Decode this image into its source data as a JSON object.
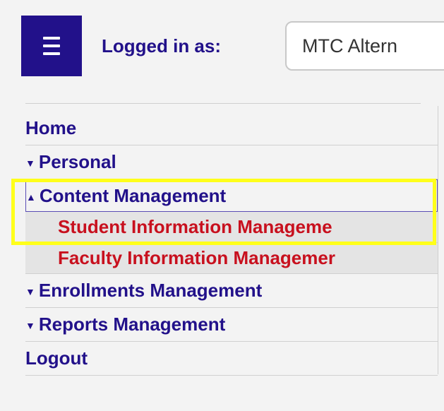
{
  "header": {
    "logged_in_label": "Logged in as:",
    "user_value": "MTC Altern"
  },
  "nav": {
    "home": "Home",
    "personal": "Personal",
    "content_management": "Content Management",
    "student_info": "Student Information Manageme",
    "faculty_info": "Faculty Information Managemer",
    "enrollments": "Enrollments Management",
    "reports": "Reports Management",
    "logout": "Logout"
  },
  "icons": {
    "menu": "hamburger-menu-icon",
    "collapsed_arrow": "triangle-down",
    "expanded_arrow": "triangle-up"
  },
  "colors": {
    "primary": "#22118a",
    "sub_item_text": "#c8101e",
    "highlight": "#ffff1a"
  }
}
